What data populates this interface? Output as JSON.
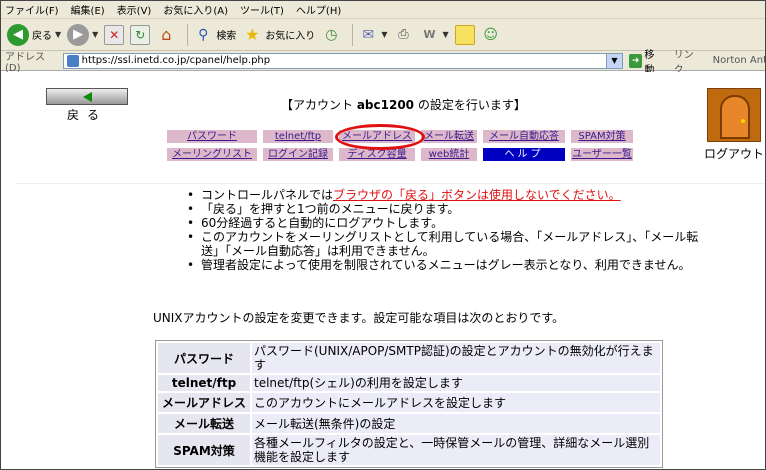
{
  "menubar": [
    "ファイル(F)",
    "編集(E)",
    "表示(V)",
    "お気に入り(A)",
    "ツール(T)",
    "ヘルプ(H)"
  ],
  "toolbar": {
    "back_label": "戻る",
    "search_label": "検索",
    "favorites_label": "お気に入り"
  },
  "address": {
    "label": "アドレス(D)",
    "url": "https://ssl.inetd.co.jp/cpanel/help.php",
    "go_label": "移動",
    "links_label": "リンク",
    "norton_label": "Norton Ant"
  },
  "page": {
    "back_text": "戻る",
    "account_title_pre": "【アカウント ",
    "account_name": "abc1200",
    "account_title_post": " の設定を行います】",
    "logout_label": "ログアウト",
    "nav_row1": [
      "パスワード",
      "telnet/ftp",
      "メールアドレス",
      "メール転送",
      "メール自動応答",
      "SPAM対策"
    ],
    "nav_row2": [
      "メーリングリスト",
      "ログイン記録",
      "ディスク容量",
      "web統計",
      "ヘルプ",
      "ユーザー一覧"
    ],
    "notes": {
      "n1_pre": "コントロールパネルでは",
      "n1_red": "ブラウザの「戻る」ボタンは使用しないでください。",
      "n2": "「戻る」を押すと1つ前のメニューに戻ります。",
      "n3": "60分経過すると自動的にログアウトします。",
      "n4": "このアカウントをメーリングリストとして利用している場合、「メールアドレス」、「メール転送」「メール自動応答」は利用できません。",
      "n5": "管理者設定によって使用を制限されているメニューはグレー表示となり、利用できません。"
    },
    "intro": "UNIXアカウントの設定を変更できます。設定可能な項目は次のとおりです。",
    "table": [
      {
        "name": "パスワード",
        "desc": "パスワード(UNIX/APOP/SMTP認証)の設定とアカウントの無効化が行えます"
      },
      {
        "name": "telnet/ftp",
        "desc": "telnet/ftp(シェル)の利用を設定します"
      },
      {
        "name": "メールアドレス",
        "desc": "このアカウントにメールアドレスを設定します"
      },
      {
        "name": "メール転送",
        "desc": "メール転送(無条件)の設定"
      },
      {
        "name": "SPAM対策",
        "desc": "各種メールフィルタの設定と、一時保管メールの管理、詳細なメール選別機能を設定します"
      }
    ]
  }
}
